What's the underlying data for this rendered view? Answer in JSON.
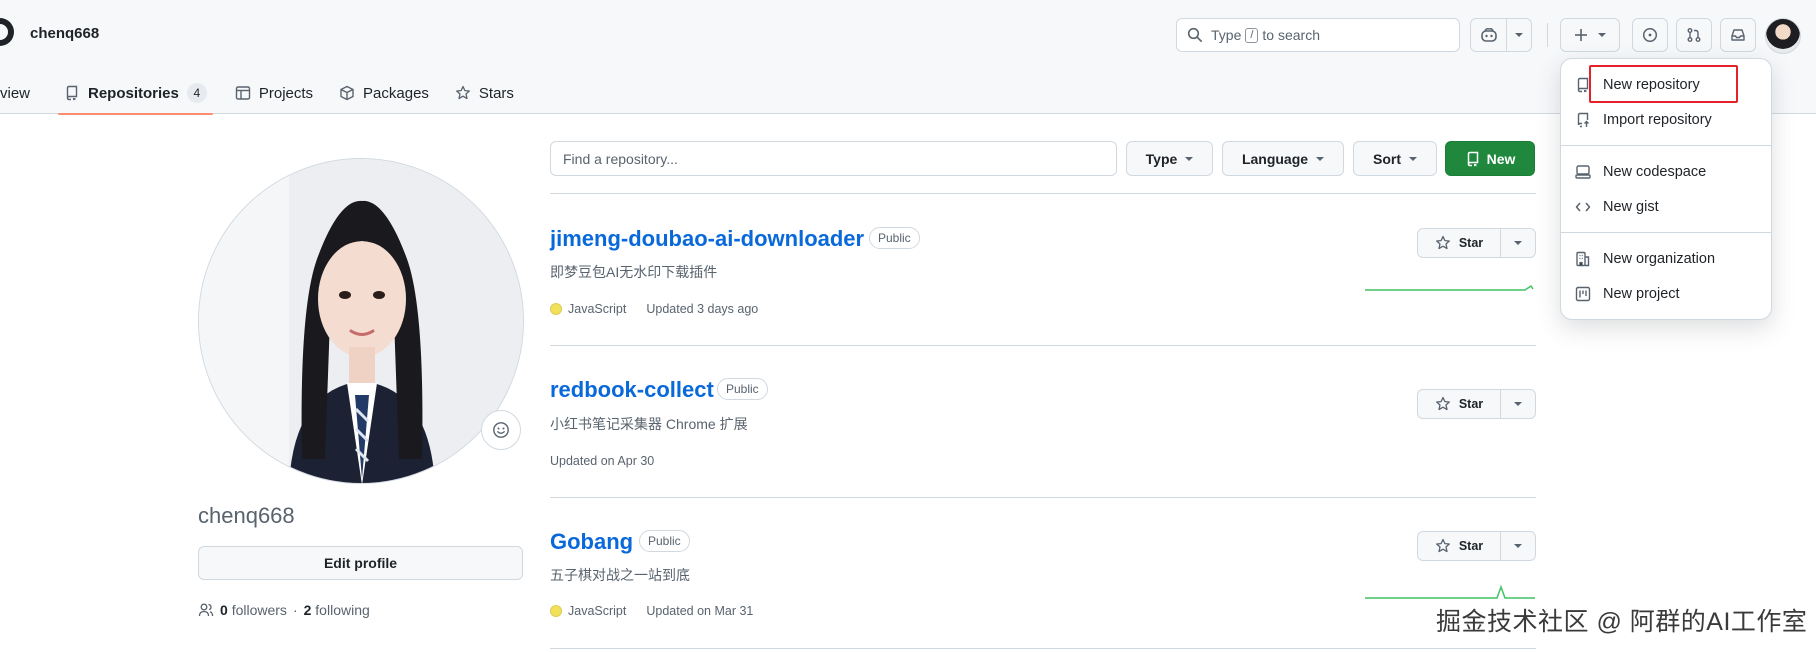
{
  "header": {
    "context_name": "chenq668",
    "search": {
      "prefix": "Type",
      "key": "/",
      "suffix": "to search"
    }
  },
  "tabs": [
    {
      "label": "Overview",
      "visible_text": "view"
    },
    {
      "label": "Repositories",
      "count": "4",
      "selected": true
    },
    {
      "label": "Projects"
    },
    {
      "label": "Packages"
    },
    {
      "label": "Stars"
    }
  ],
  "profile": {
    "username": "chenq668",
    "edit_label": "Edit profile",
    "followers_count": "0",
    "followers_label": "followers",
    "separator": "·",
    "following_count": "2",
    "following_label": "following"
  },
  "filter": {
    "placeholder": "Find a repository...",
    "type_label": "Type",
    "language_label": "Language",
    "sort_label": "Sort",
    "new_label": "New"
  },
  "repos": [
    {
      "name": "jimeng-doubao-ai-downloader",
      "visibility": "Public",
      "description": "即梦豆包AI无水印下载插件",
      "language": "JavaScript",
      "updated": "Updated 3 days ago",
      "star_label": "Star"
    },
    {
      "name": "redbook-collect",
      "visibility": "Public",
      "description": "小红书笔记采集器 Chrome 扩展",
      "language": "",
      "updated": "Updated on Apr 30",
      "star_label": "Star"
    },
    {
      "name": "Gobang",
      "visibility": "Public",
      "description": "五子棋对战之一站到底",
      "language": "JavaScript",
      "updated": "Updated on Mar 31",
      "star_label": "Star"
    }
  ],
  "create_menu": {
    "items": [
      {
        "label": "New repository",
        "icon": "repo-icon",
        "highlighted": true
      },
      {
        "label": "Import repository",
        "icon": "repo-push-icon"
      },
      {
        "label": "New codespace",
        "icon": "codespace-icon"
      },
      {
        "label": "New gist",
        "icon": "code-icon"
      },
      {
        "label": "New organization",
        "icon": "organization-icon"
      },
      {
        "label": "New project",
        "icon": "project-icon"
      }
    ]
  },
  "colors": {
    "accent_green": "#1f883d",
    "link_blue": "#0969da",
    "tab_underline": "#fd8c73",
    "javascript": "#f1e05a",
    "highlight_red": "#e5222a"
  },
  "watermark": "掘金技术社区 @ 阿群的AI工作室"
}
